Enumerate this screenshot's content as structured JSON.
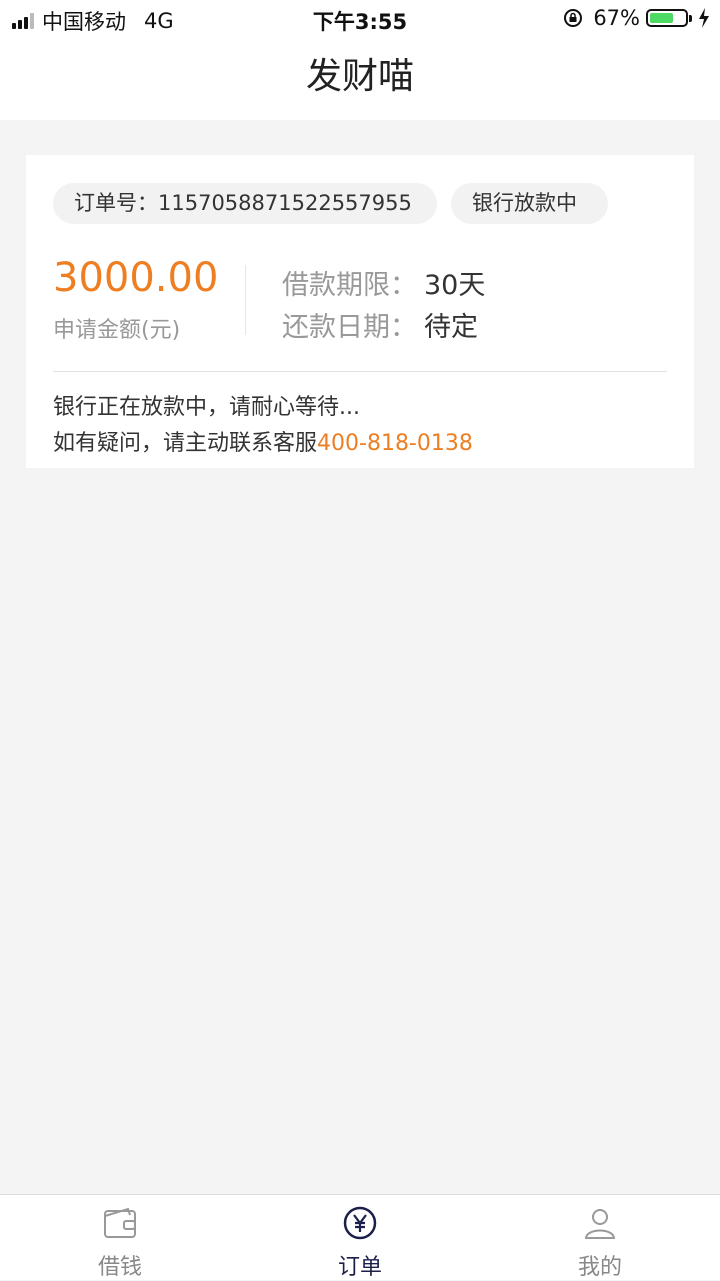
{
  "status_bar": {
    "carrier": "中国移动",
    "network": "4G",
    "time": "下午3:55",
    "battery": "67%",
    "battery_level": 0.67
  },
  "header": {
    "title": "发财喵"
  },
  "order": {
    "order_no_label": "订单号：1157058871522557955",
    "status": "银行放款中",
    "amount": "3000.00",
    "amount_label": "申请金额(元)",
    "term_label": "借款期限：",
    "term_value": "30天",
    "repay_label": "还款日期：",
    "repay_value": "待定",
    "message_line1": "银行正在放款中，请耐心等待...",
    "message_line2_prefix": "如有疑问，请主动联系客服",
    "service_phone": "400-818-0138"
  },
  "tabs": [
    {
      "label": "借钱",
      "icon": "wallet-icon",
      "active": false
    },
    {
      "label": "订单",
      "icon": "yen-circle-icon",
      "active": true
    },
    {
      "label": "我的",
      "icon": "user-icon",
      "active": false
    }
  ],
  "colors": {
    "accent": "#ee7e22",
    "tab_active": "#1c1f4a",
    "background": "#f4f4f4"
  }
}
